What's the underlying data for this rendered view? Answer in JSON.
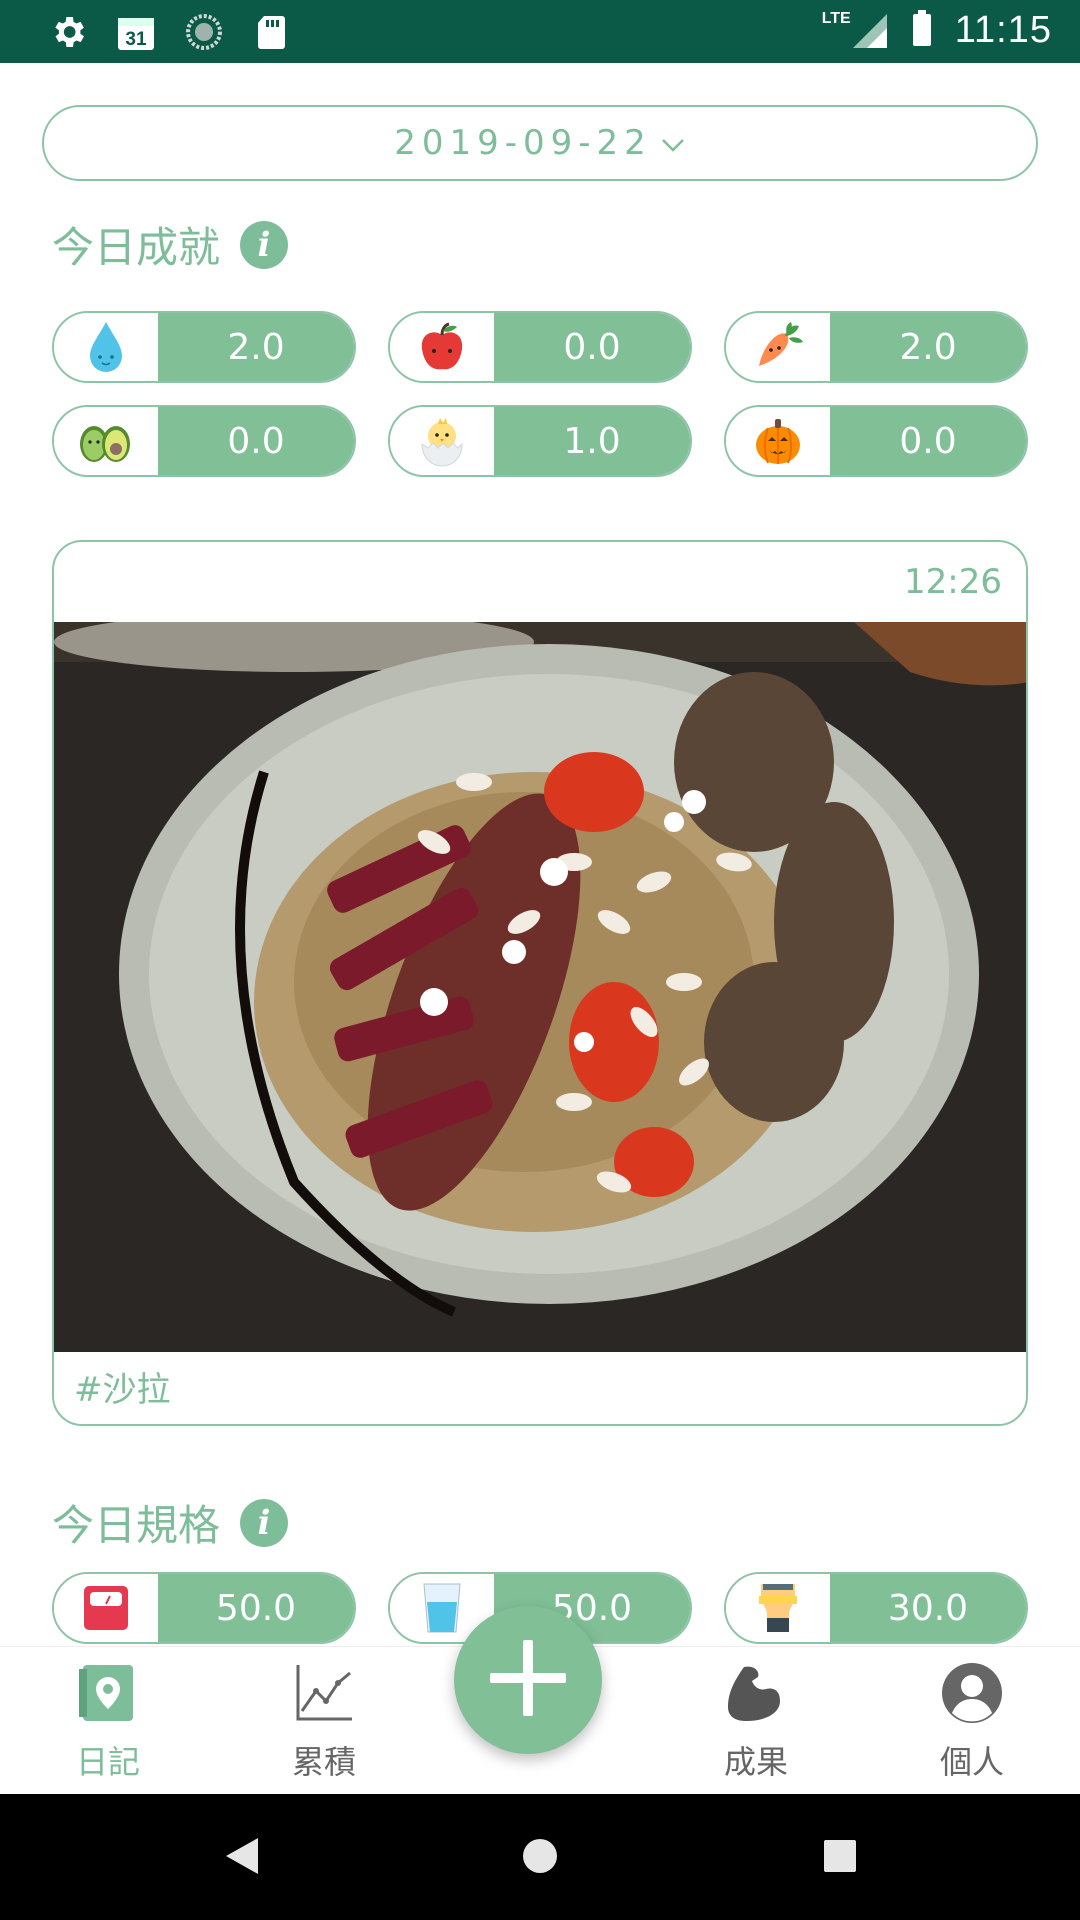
{
  "status_bar": {
    "calendar_day": "31",
    "network": "LTE",
    "time": "11:15"
  },
  "date_picker": {
    "value": "2019-09-22"
  },
  "achievements": {
    "title": "今日成就",
    "items": [
      {
        "icon": "water-drop-icon",
        "value": "2.0"
      },
      {
        "icon": "apple-icon",
        "value": "0.0"
      },
      {
        "icon": "carrot-icon",
        "value": "2.0"
      },
      {
        "icon": "avocado-icon",
        "value": "0.0"
      },
      {
        "icon": "chick-egg-icon",
        "value": "1.0"
      },
      {
        "icon": "pumpkin-icon",
        "value": "0.0"
      }
    ]
  },
  "meal": {
    "time": "12:26",
    "tag": "#沙拉"
  },
  "specs": {
    "title": "今日規格",
    "items": [
      {
        "icon": "scale-icon",
        "value": "50.0"
      },
      {
        "icon": "water-glass-icon",
        "value": "50.0"
      },
      {
        "icon": "waist-measure-icon",
        "value": "30.0"
      }
    ]
  },
  "bottom_nav": {
    "items": [
      {
        "label": "日記",
        "icon": "diary-icon",
        "active": true
      },
      {
        "label": "累積",
        "icon": "chart-icon",
        "active": false
      },
      {
        "label": "成果",
        "icon": "muscle-icon",
        "active": false
      },
      {
        "label": "個人",
        "icon": "profile-icon",
        "active": false
      }
    ]
  },
  "colors": {
    "accent": "#81bf97",
    "accent_text": "#7ebd99",
    "status_bar": "#0b5a47"
  }
}
